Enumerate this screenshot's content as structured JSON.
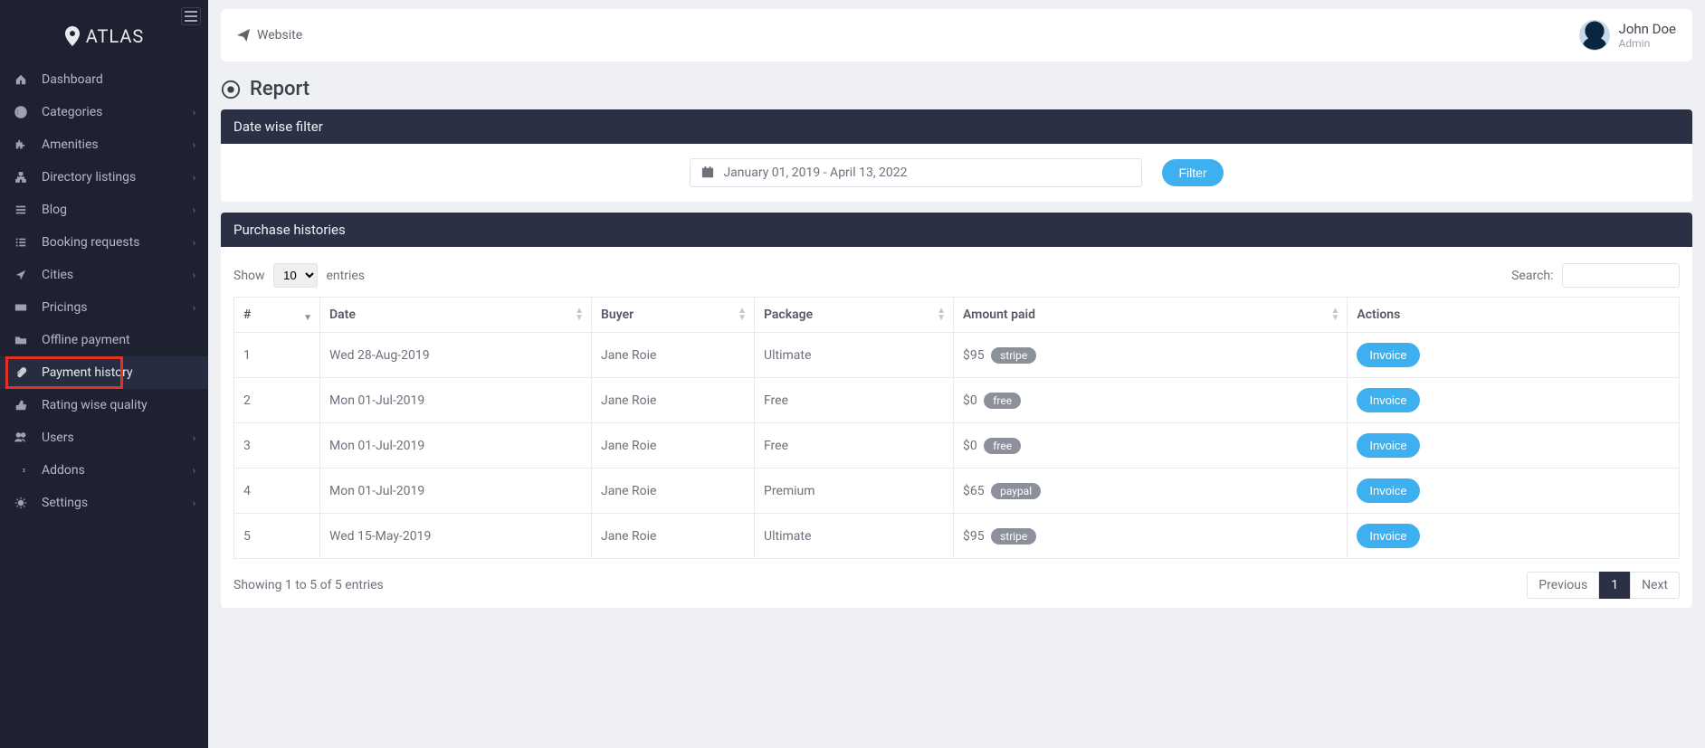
{
  "brand": "ATLAS",
  "sidebar": {
    "items": [
      {
        "label": "Dashboard",
        "icon": "home",
        "expandable": false,
        "active": false
      },
      {
        "label": "Categories",
        "icon": "globe",
        "expandable": true,
        "active": false
      },
      {
        "label": "Amenities",
        "icon": "puzzle",
        "expandable": true,
        "active": false
      },
      {
        "label": "Directory listings",
        "icon": "sitemap",
        "expandable": true,
        "active": false
      },
      {
        "label": "Blog",
        "icon": "list",
        "expandable": true,
        "active": false
      },
      {
        "label": "Booking requests",
        "icon": "tasks",
        "expandable": true,
        "active": false
      },
      {
        "label": "Cities",
        "icon": "location-arrow",
        "expandable": true,
        "active": false
      },
      {
        "label": "Pricings",
        "icon": "credit-card",
        "expandable": true,
        "active": false
      },
      {
        "label": "Offline payment",
        "icon": "folder",
        "expandable": false,
        "active": false
      },
      {
        "label": "Payment history",
        "icon": "paperclip",
        "expandable": false,
        "active": true,
        "highlight": true
      },
      {
        "label": "Rating wise quality",
        "icon": "thumbs-up",
        "expandable": false,
        "active": false
      },
      {
        "label": "Users",
        "icon": "users",
        "expandable": true,
        "active": false
      },
      {
        "label": "Addons",
        "icon": "superscript",
        "expandable": true,
        "active": false
      },
      {
        "label": "Settings",
        "icon": "cogs",
        "expandable": true,
        "active": false
      }
    ]
  },
  "topbar": {
    "website_label": "Website",
    "user_name": "John Doe",
    "user_role": "Admin"
  },
  "page": {
    "title": "Report"
  },
  "filter_panel": {
    "title": "Date wise filter",
    "date_range": "January 01, 2019 - April 13, 2022",
    "filter_label": "Filter"
  },
  "history_panel": {
    "title": "Purchase histories",
    "show_label_pre": "Show",
    "show_label_post": "entries",
    "show_value": "10",
    "search_label": "Search:",
    "columns": [
      "#",
      "Date",
      "Buyer",
      "Package",
      "Amount paid",
      "Actions"
    ],
    "rows": [
      {
        "n": "1",
        "date": "Wed 28-Aug-2019",
        "buyer": "Jane Roie",
        "package": "Ultimate",
        "amount": "$95",
        "method": "stripe"
      },
      {
        "n": "2",
        "date": "Mon 01-Jul-2019",
        "buyer": "Jane Roie",
        "package": "Free",
        "amount": "$0",
        "method": "free"
      },
      {
        "n": "3",
        "date": "Mon 01-Jul-2019",
        "buyer": "Jane Roie",
        "package": "Free",
        "amount": "$0",
        "method": "free"
      },
      {
        "n": "4",
        "date": "Mon 01-Jul-2019",
        "buyer": "Jane Roie",
        "package": "Premium",
        "amount": "$65",
        "method": "paypal"
      },
      {
        "n": "5",
        "date": "Wed 15-May-2019",
        "buyer": "Jane Roie",
        "package": "Ultimate",
        "amount": "$95",
        "method": "stripe"
      }
    ],
    "invoice_label": "Invoice",
    "footer_info": "Showing 1 to 5 of 5 entries",
    "pager": {
      "prev": "Previous",
      "current": "1",
      "next": "Next"
    }
  }
}
